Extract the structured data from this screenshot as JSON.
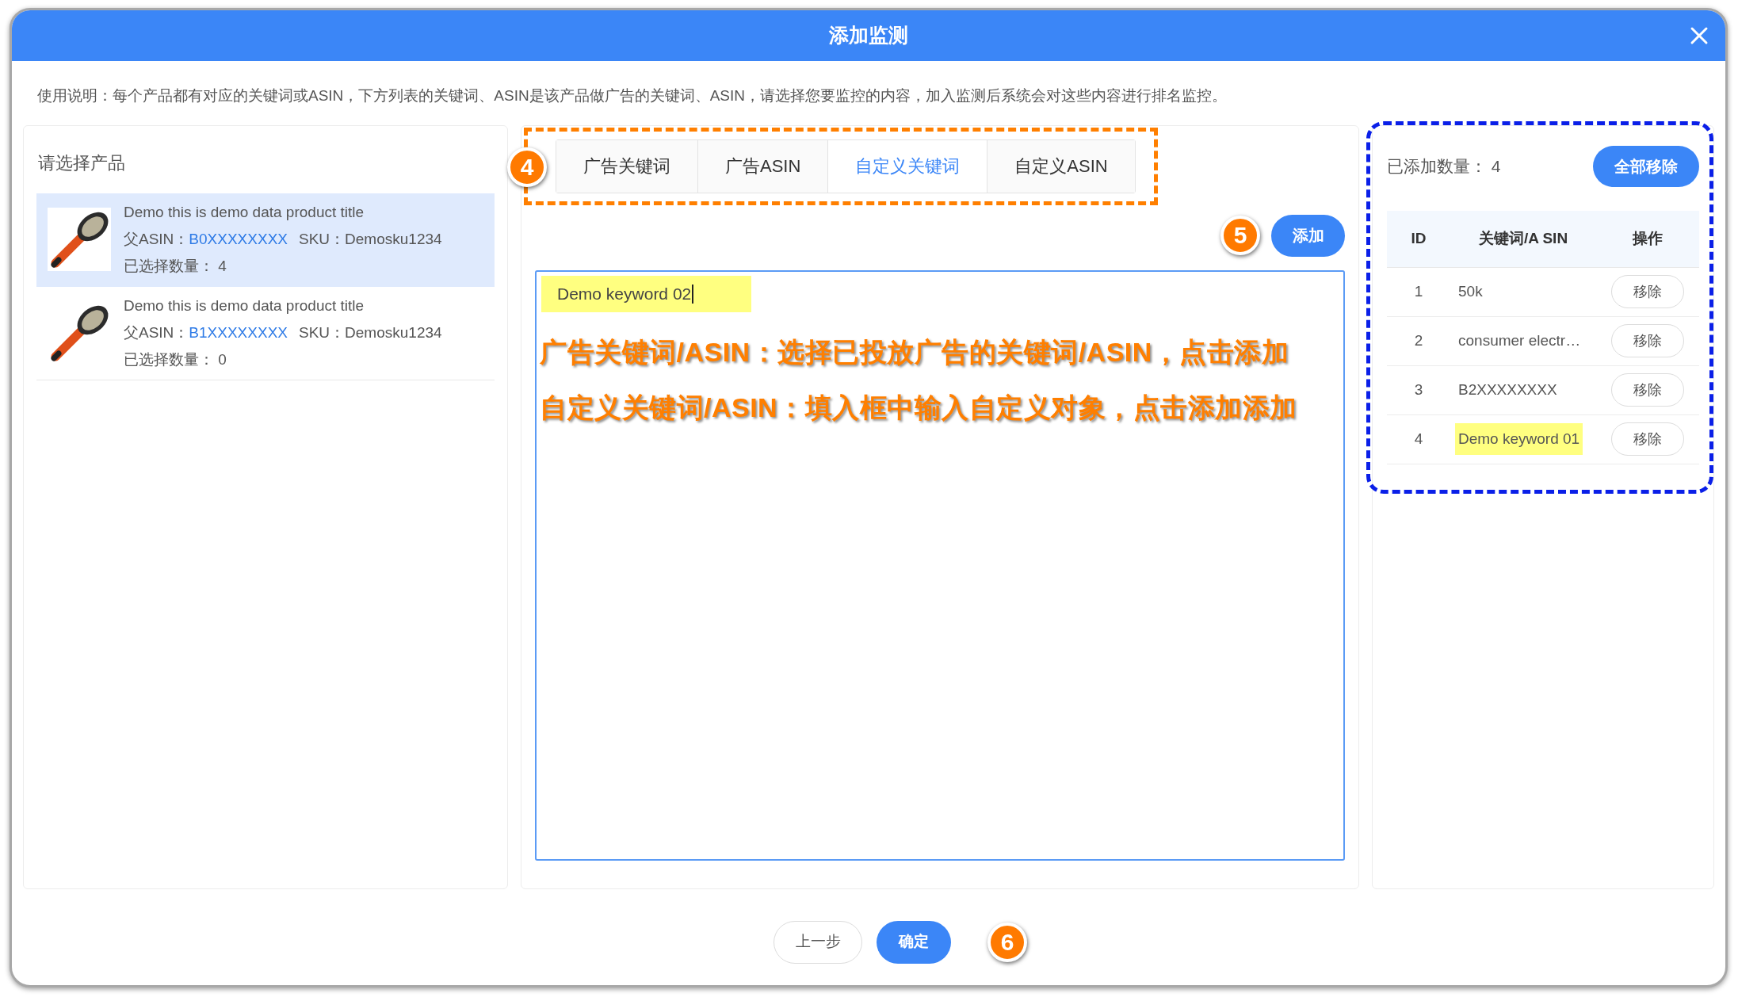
{
  "dialog": {
    "title": "添加监测",
    "instructions": "使用说明：每个产品都有对应的关键词或ASIN，下方列表的关键词、ASIN是该产品做广告的关键词、ASIN，请选择您要监控的内容，加入监测后系统会对这些内容进行排名监控。"
  },
  "products": {
    "heading": "请选择产品",
    "items": [
      {
        "title": "Demo this is demo data product title",
        "asin_label": "父ASIN：",
        "asin": "B0XXXXXXXX",
        "sku_label": "SKU：",
        "sku": "Demosku1234",
        "count_label": "已选择数量：",
        "count": "4",
        "selected": true
      },
      {
        "title": "Demo this is demo data product title",
        "asin_label": "父ASIN：",
        "asin": "B1XXXXXXXX",
        "sku_label": "SKU：",
        "sku": "Demosku1234",
        "count_label": "已选择数量：",
        "count": "0",
        "selected": false
      }
    ]
  },
  "tab_section": {
    "step": "4",
    "tabs": [
      {
        "label": "广告关键词",
        "selected": false
      },
      {
        "label": "广告ASIN",
        "selected": false
      },
      {
        "label": "自定义关键词",
        "selected": true
      },
      {
        "label": "自定义ASIN",
        "selected": false
      }
    ]
  },
  "add_button": {
    "label": "添加",
    "step": "5"
  },
  "keyword_box": {
    "value": "Demo keyword 02",
    "highlighted": true,
    "notes": [
      "广告关键词/ASIN：选择已投放广告的关键词/ASIN，点击添加",
      "自定义关键词/ASIN：填入框中输入自定义对象，点击添加添加"
    ]
  },
  "added": {
    "count_label": "已添加数量：",
    "count": "4",
    "remove_all": "全部移除",
    "columns": [
      "ID",
      "关键词/A SIN",
      "操作"
    ],
    "rows": [
      {
        "id": "1",
        "keyword": "50k",
        "action": "移除",
        "highlighted": false
      },
      {
        "id": "2",
        "keyword": "consumer electr…",
        "action": "移除",
        "highlighted": false
      },
      {
        "id": "3",
        "keyword": "B2XXXXXXXX",
        "action": "移除",
        "highlighted": false
      },
      {
        "id": "4",
        "keyword": "Demo keyword 01",
        "action": "移除",
        "highlighted": true
      }
    ]
  },
  "footer": {
    "back": "上一步",
    "confirm": "确定",
    "step": "6"
  }
}
